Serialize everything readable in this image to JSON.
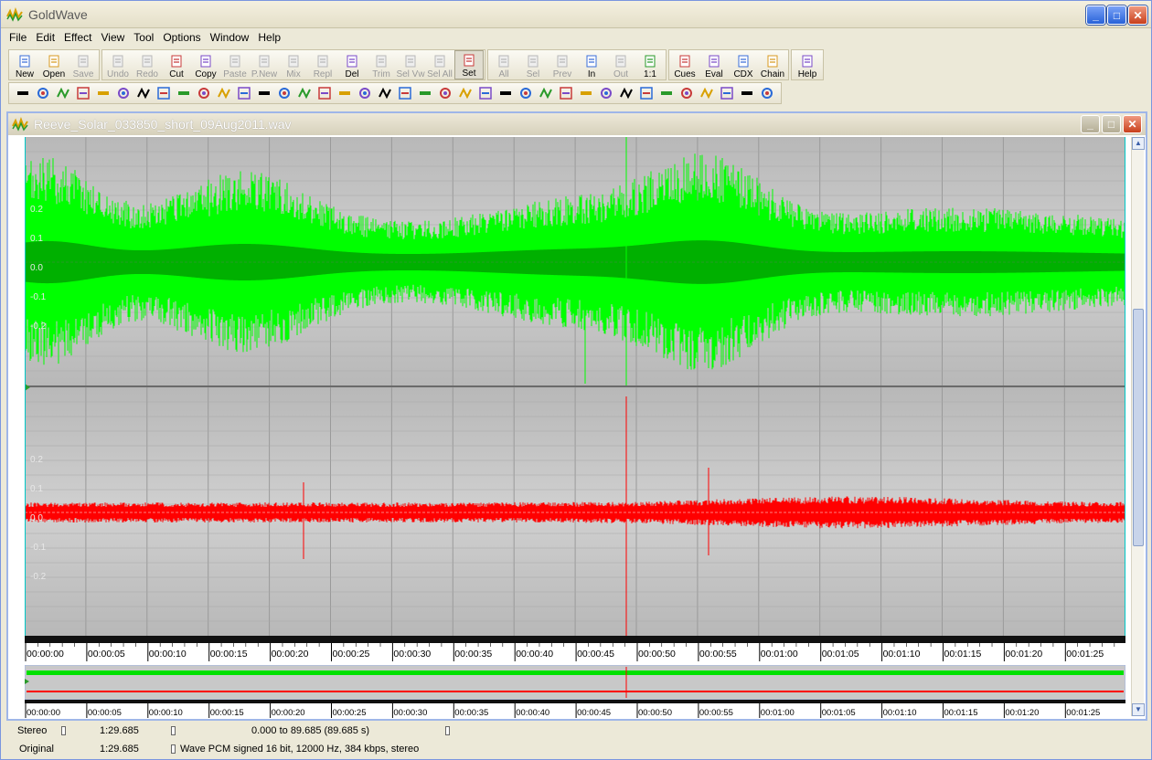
{
  "app": {
    "title": "GoldWave"
  },
  "menu": [
    "File",
    "Edit",
    "Effect",
    "View",
    "Tool",
    "Options",
    "Window",
    "Help"
  ],
  "toolbar": {
    "groups": [
      [
        {
          "label": "New",
          "icon": "new-icon",
          "enabled": true
        },
        {
          "label": "Open",
          "icon": "open-icon",
          "enabled": true
        },
        {
          "label": "Save",
          "icon": "save-icon",
          "enabled": false
        }
      ],
      [
        {
          "label": "Undo",
          "icon": "undo-icon",
          "enabled": false
        },
        {
          "label": "Redo",
          "icon": "redo-icon",
          "enabled": false
        },
        {
          "label": "Cut",
          "icon": "cut-icon",
          "enabled": true
        },
        {
          "label": "Copy",
          "icon": "copy-icon",
          "enabled": true
        },
        {
          "label": "Paste",
          "icon": "paste-icon",
          "enabled": false
        },
        {
          "label": "P.New",
          "icon": "paste-new-icon",
          "enabled": false
        },
        {
          "label": "Mix",
          "icon": "mix-icon",
          "enabled": false
        },
        {
          "label": "Repl",
          "icon": "replace-icon",
          "enabled": false
        },
        {
          "label": "Del",
          "icon": "delete-icon",
          "enabled": true
        },
        {
          "label": "Trim",
          "icon": "trim-icon",
          "enabled": false
        },
        {
          "label": "Sel Vw",
          "icon": "select-view-icon",
          "enabled": false
        },
        {
          "label": "Sel All",
          "icon": "select-all-icon",
          "enabled": false
        },
        {
          "label": "Set",
          "icon": "set-icon",
          "enabled": true,
          "active": true
        }
      ],
      [
        {
          "label": "All",
          "icon": "zoom-all-icon",
          "enabled": false
        },
        {
          "label": "Sel",
          "icon": "zoom-sel-icon",
          "enabled": false
        },
        {
          "label": "Prev",
          "icon": "zoom-prev-icon",
          "enabled": false
        },
        {
          "label": "In",
          "icon": "zoom-in-icon",
          "enabled": true
        },
        {
          "label": "Out",
          "icon": "zoom-out-icon",
          "enabled": false
        },
        {
          "label": "1:1",
          "icon": "zoom-1to1-icon",
          "enabled": true
        }
      ],
      [
        {
          "label": "Cues",
          "icon": "cues-icon",
          "enabled": true
        },
        {
          "label": "Eval",
          "icon": "eval-icon",
          "enabled": true
        },
        {
          "label": "CDX",
          "icon": "cdx-icon",
          "enabled": true
        },
        {
          "label": "Chain",
          "icon": "chain-icon",
          "enabled": true
        }
      ],
      [
        {
          "label": "Help",
          "icon": "help-icon",
          "enabled": true
        }
      ]
    ],
    "effects_count": 38
  },
  "document": {
    "title": "Reeve_Solar_033850_short_09Aug2011.wav",
    "channel_colors": {
      "left": "#00ff00",
      "right": "#ff0000"
    },
    "left_axis_labels": [
      "0.2",
      "0.1",
      "0.0",
      "-0.1",
      "-0.2"
    ],
    "right_axis_labels": [
      "0.2",
      "0.1",
      "0.0",
      "-0.1",
      "-0.2"
    ],
    "time_ticks": [
      "00:00:00",
      "00:00:05",
      "00:00:10",
      "00:00:15",
      "00:00:20",
      "00:00:25",
      "00:00:30",
      "00:00:35",
      "00:00:40",
      "00:00:45",
      "00:00:50",
      "00:00:55",
      "00:01:00",
      "00:01:05",
      "00:01:10",
      "00:01:15",
      "00:01:20",
      "00:01:25"
    ]
  },
  "status": {
    "row1": {
      "channels": "Stereo",
      "length": "1:29.685",
      "selection": "0.000 to 89.685 (89.685 s)"
    },
    "row2": {
      "mode": "Original",
      "length": "1:29.685",
      "format": "Wave PCM signed 16 bit, 12000 Hz, 384 kbps, stereo"
    }
  }
}
